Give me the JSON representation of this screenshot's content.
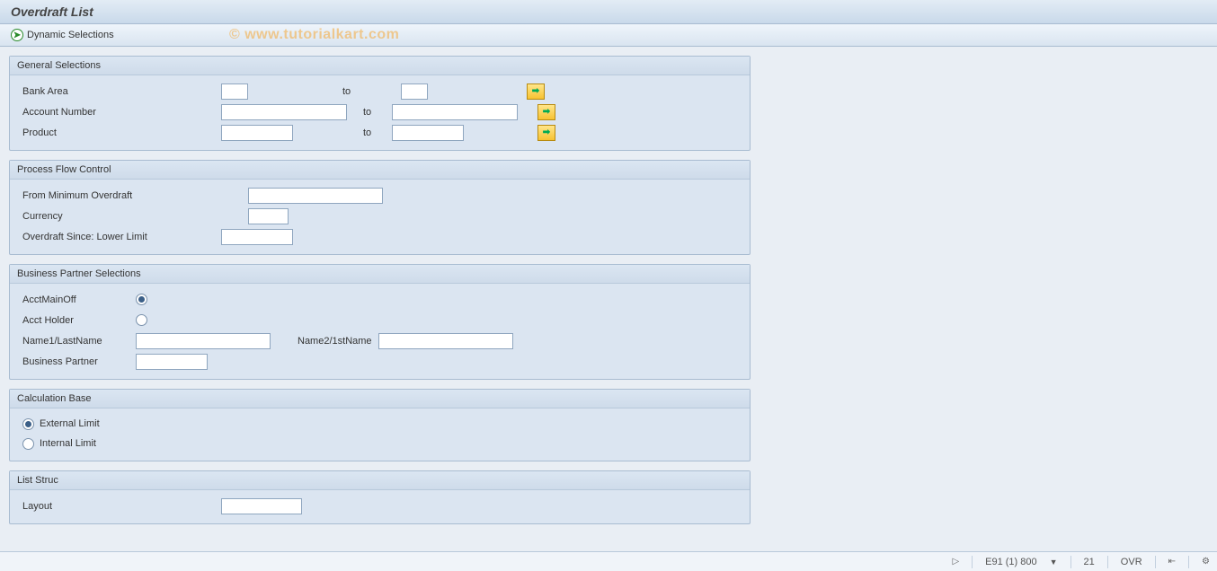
{
  "title": "Overdraft List",
  "toolbar": {
    "dynamic_selections": "Dynamic Selections"
  },
  "watermark": "© www.tutorialkart.com",
  "to_label": "to",
  "panels": {
    "general": {
      "title": "General Selections",
      "rows": {
        "bank_area": {
          "label": "Bank Area",
          "from": "",
          "to": ""
        },
        "account_number": {
          "label": "Account Number",
          "from": "",
          "to": ""
        },
        "product": {
          "label": "Product",
          "from": "",
          "to": ""
        }
      }
    },
    "process_flow": {
      "title": "Process Flow Control",
      "rows": {
        "min_overdraft": {
          "label": "From Minimum Overdraft",
          "value": ""
        },
        "currency": {
          "label": "Currency",
          "value": ""
        },
        "overdraft_since": {
          "label": "Overdraft Since: Lower Limit",
          "value": ""
        }
      }
    },
    "bp": {
      "title": "Business Partner Selections",
      "acct_main_off": "AcctMainOff",
      "acct_holder": "Acct Holder",
      "name1_label": "Name1/LastName",
      "name1_value": "",
      "name2_label": "Name2/1stName",
      "name2_value": "",
      "bp_label": "Business Partner",
      "bp_value": ""
    },
    "calc": {
      "title": "Calculation Base",
      "external": "External Limit",
      "internal": "Internal Limit"
    },
    "list": {
      "title": "List Struc",
      "layout_label": "Layout",
      "layout_value": ""
    }
  },
  "status": {
    "system": "E91 (1) 800",
    "client": "21",
    "mode": "OVR"
  }
}
